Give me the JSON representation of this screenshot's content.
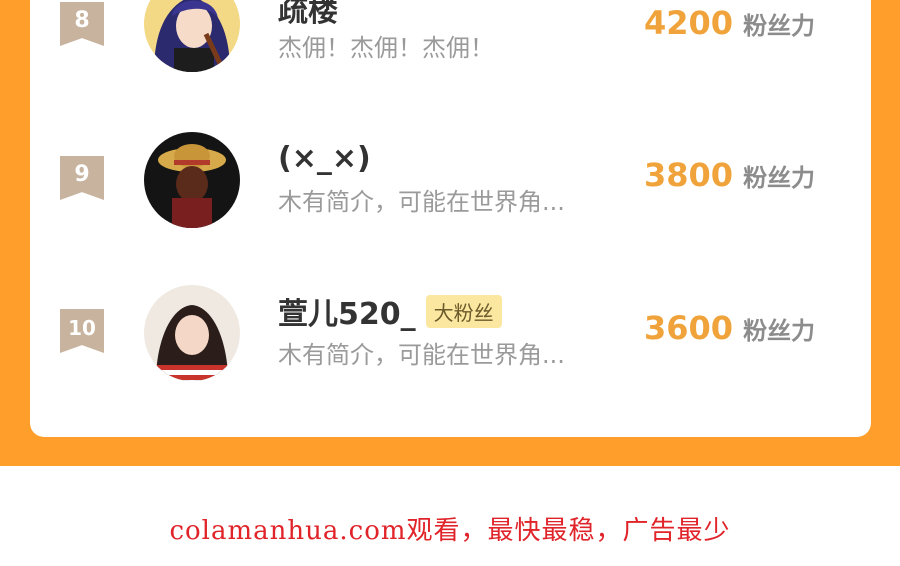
{
  "ranking": [
    {
      "rank": "8",
      "name": "疏楼",
      "badge": "",
      "bio": "杰佣！杰佣！杰佣！",
      "fans": "4200",
      "fans_unit": "粉丝力",
      "avatar_icon": "anime-girl-violin-avatar"
    },
    {
      "rank": "9",
      "name": "(×_×)",
      "badge": "",
      "bio": "木有简介，可能在世界角...",
      "fans": "3800",
      "fans_unit": "粉丝力",
      "avatar_icon": "straw-hat-character-avatar"
    },
    {
      "rank": "10",
      "name": "萱儿520_",
      "badge": "大粉丝",
      "bio": "木有简介，可能在世界角...",
      "fans": "3600",
      "fans_unit": "粉丝力",
      "avatar_icon": "girl-photo-avatar"
    }
  ],
  "footer": {
    "text": "colamanhua.com观看，最快最稳，广告最少"
  },
  "colors": {
    "orange": "#ff9e2a",
    "rank_badge": "#c8b39e",
    "fans_number": "#f0a33a",
    "footer_text": "#e0242a"
  }
}
